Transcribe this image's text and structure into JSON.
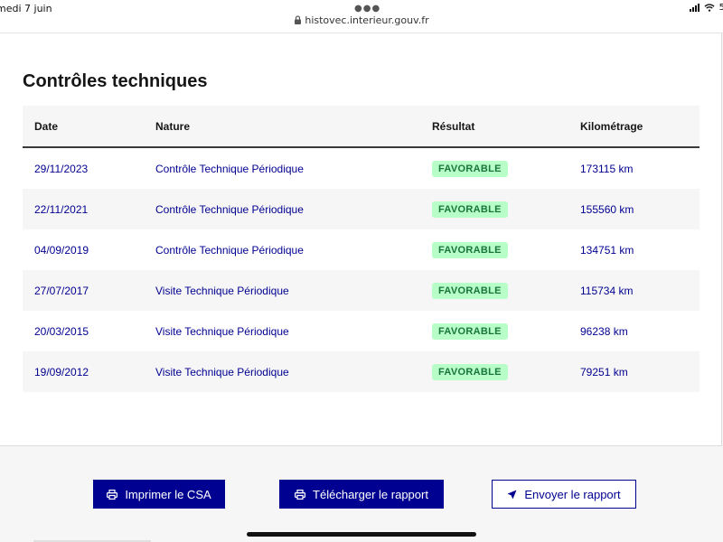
{
  "status_bar": {
    "time": "medi 7 juin",
    "url": "histovec.interieur.gouv.fr",
    "battery": "5"
  },
  "section": {
    "title": "Contrôles techniques"
  },
  "table": {
    "headers": {
      "date": "Date",
      "nature": "Nature",
      "result": "Résultat",
      "mileage": "Kilométrage"
    },
    "rows": [
      {
        "date": "29/11/2023",
        "nature": "Contrôle Technique Périodique",
        "result": "FAVORABLE",
        "mileage": "173115 km"
      },
      {
        "date": "22/11/2021",
        "nature": "Contrôle Technique Périodique",
        "result": "FAVORABLE",
        "mileage": "155560 km"
      },
      {
        "date": "04/09/2019",
        "nature": "Contrôle Technique Périodique",
        "result": "FAVORABLE",
        "mileage": "134751 km"
      },
      {
        "date": "27/07/2017",
        "nature": "Visite Technique Périodique",
        "result": "FAVORABLE",
        "mileage": "115734 km"
      },
      {
        "date": "20/03/2015",
        "nature": "Visite Technique Périodique",
        "result": "FAVORABLE",
        "mileage": "96238 km"
      },
      {
        "date": "19/09/2012",
        "nature": "Visite Technique Périodique",
        "result": "FAVORABLE",
        "mileage": "79251 km"
      }
    ]
  },
  "actions": {
    "print_label": "Imprimer le CSA",
    "download_label": "Télécharger le rapport",
    "send_label": "Envoyer le rapport"
  },
  "icons": {
    "print": "printer-icon",
    "download": "printer-icon",
    "send": "send-arrow-icon",
    "lock": "lock-icon"
  },
  "colors": {
    "primary": "#000091",
    "badge_bg": "#b8fec9",
    "badge_text": "#18753c",
    "header_bg": "#f6f6f6"
  }
}
